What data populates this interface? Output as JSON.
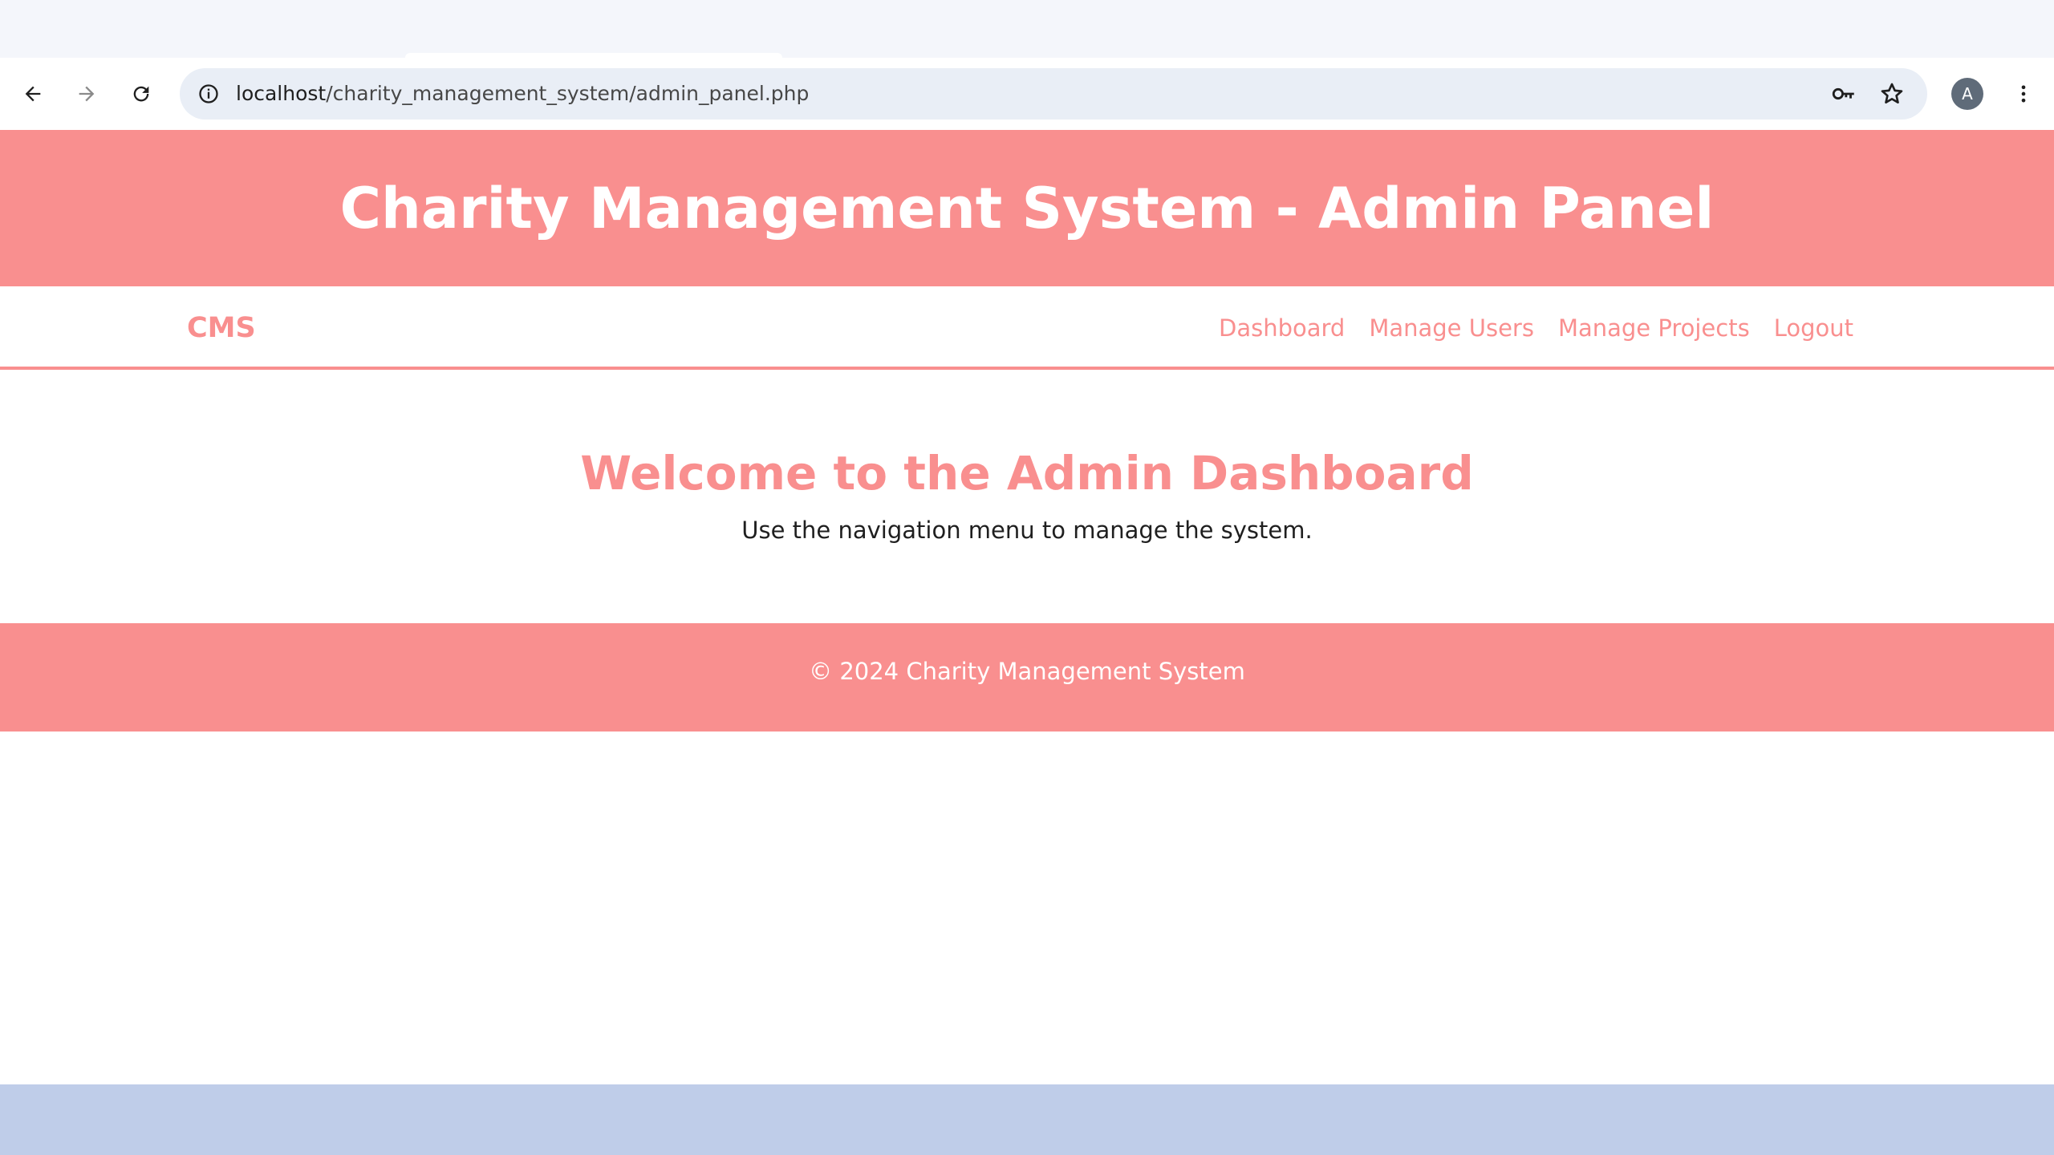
{
  "browser": {
    "url_host": "localhost",
    "url_path": "/charity_management_system/admin_panel.php",
    "profile_initial": "A",
    "icons": {
      "back": "arrow-left-icon",
      "forward": "arrow-right-icon",
      "reload": "reload-icon",
      "site_info": "info-icon",
      "passwords": "key-icon",
      "bookmark": "star-icon",
      "menu": "three-dots-icon"
    }
  },
  "header": {
    "title": "Charity Management System - Admin Panel"
  },
  "nav": {
    "brand": "CMS",
    "links": [
      "Dashboard",
      "Manage Users",
      "Manage Projects",
      "Logout"
    ]
  },
  "main": {
    "heading": "Welcome to the Admin Dashboard",
    "subtext": "Use the navigation menu to manage the system."
  },
  "footer": {
    "text": "© 2024 Charity Management System"
  },
  "colors": {
    "accent": "#f98f8f",
    "taskbar": "#bfcde9",
    "omnibox": "#e9eef6"
  }
}
